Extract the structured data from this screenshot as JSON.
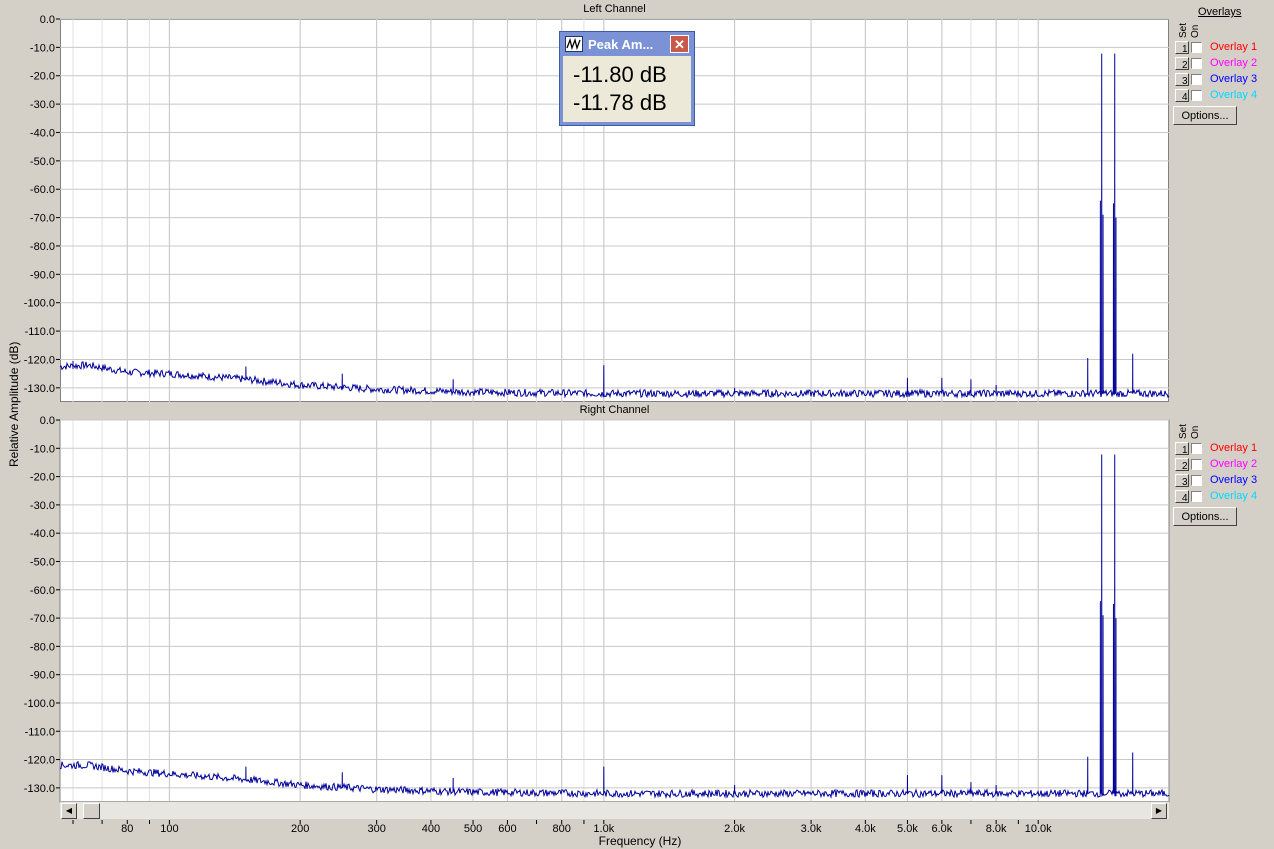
{
  "chart_data": [
    {
      "type": "line",
      "title": "Left Channel",
      "xlabel": "Frequency (Hz)",
      "ylabel": "Relative Amplitude (dB)",
      "xscale": "log",
      "xlim": [
        56,
        20000
      ],
      "ylim": [
        -135,
        0
      ],
      "grid": true,
      "y_ticks": [
        "0.0",
        "-10.0",
        "-20.0",
        "-30.0",
        "-40.0",
        "-50.0",
        "-60.0",
        "-70.0",
        "-80.0",
        "-90.0",
        "-100.0",
        "-110.0",
        "-120.0",
        "-130.0"
      ],
      "x_tick_values": [
        80,
        100,
        200,
        300,
        400,
        500,
        600,
        800,
        1000,
        2000,
        3000,
        4000,
        5000,
        6000,
        8000,
        10000
      ],
      "x_tick_labels": [
        "80",
        "100",
        "200",
        "300",
        "400",
        "500",
        "600",
        "800",
        "1.0k",
        "2.0k",
        "3.0k",
        "4.0k",
        "5.0k",
        "6.0k",
        "8.0k",
        "10.0k"
      ],
      "series": [
        {
          "color": "#000099",
          "baseline": [
            [
              56,
              -122.5
            ],
            [
              65,
              -122
            ],
            [
              80,
              -124.5
            ],
            [
              100,
              -125
            ],
            [
              150,
              -127
            ],
            [
              200,
              -129
            ],
            [
              300,
              -130.5
            ],
            [
              500,
              -131.5
            ],
            [
              1000,
              -132
            ],
            [
              2000,
              -132
            ],
            [
              5000,
              -132
            ],
            [
              10000,
              -132
            ],
            [
              20000,
              -132
            ]
          ],
          "peaks": [
            [
              60,
              -120.5
            ],
            [
              150,
              -122.5
            ],
            [
              250,
              -125
            ],
            [
              450,
              -127
            ],
            [
              1000,
              -122
            ],
            [
              2000,
              -130
            ],
            [
              5000,
              -126.5
            ],
            [
              6000,
              -126.5
            ],
            [
              7000,
              -127
            ],
            [
              8000,
              -129
            ],
            [
              13000,
              -119.5
            ],
            [
              14000,
              -12.2
            ],
            [
              15000,
              -12.2
            ],
            [
              16500,
              -118
            ],
            [
              13900,
              -64
            ],
            [
              14100,
              -69
            ],
            [
              14900,
              -65
            ],
            [
              15100,
              -70
            ]
          ]
        }
      ]
    },
    {
      "type": "line",
      "title": "Right Channel",
      "xlabel": "Frequency (Hz)",
      "ylabel": "Relative Amplitude (dB)",
      "xscale": "log",
      "xlim": [
        56,
        20000
      ],
      "ylim": [
        -135,
        0
      ],
      "grid": true,
      "y_ticks": [
        "0.0",
        "-10.0",
        "-20.0",
        "-30.0",
        "-40.0",
        "-50.0",
        "-60.0",
        "-70.0",
        "-80.0",
        "-90.0",
        "-100.0",
        "-110.0",
        "-120.0",
        "-130.0"
      ],
      "x_tick_values": [
        80,
        100,
        200,
        300,
        400,
        500,
        600,
        800,
        1000,
        2000,
        3000,
        4000,
        5000,
        6000,
        8000,
        10000
      ],
      "x_tick_labels": [
        "80",
        "100",
        "200",
        "300",
        "400",
        "500",
        "600",
        "800",
        "1.0k",
        "2.0k",
        "3.0k",
        "4.0k",
        "5.0k",
        "6.0k",
        "8.0k",
        "10.0k"
      ],
      "series": [
        {
          "color": "#000099",
          "baseline": [
            [
              56,
              -122
            ],
            [
              65,
              -122
            ],
            [
              80,
              -124
            ],
            [
              100,
              -125
            ],
            [
              150,
              -127
            ],
            [
              200,
              -129
            ],
            [
              300,
              -130.5
            ],
            [
              500,
              -131.5
            ],
            [
              1000,
              -132
            ],
            [
              2000,
              -132
            ],
            [
              5000,
              -132
            ],
            [
              10000,
              -132
            ],
            [
              20000,
              -132
            ]
          ],
          "peaks": [
            [
              150,
              -122.5
            ],
            [
              250,
              -124.5
            ],
            [
              450,
              -126.5
            ],
            [
              1000,
              -122.5
            ],
            [
              2000,
              -129
            ],
            [
              5000,
              -125.5
            ],
            [
              6000,
              -125.5
            ],
            [
              7000,
              -128
            ],
            [
              8000,
              -129
            ],
            [
              13000,
              -119
            ],
            [
              14000,
              -12.2
            ],
            [
              15000,
              -12.2
            ],
            [
              16500,
              -117.5
            ],
            [
              13900,
              -64
            ],
            [
              14100,
              -69
            ],
            [
              14900,
              -65
            ],
            [
              15100,
              -70
            ]
          ]
        }
      ]
    }
  ],
  "xlabel": "Frequency (Hz)",
  "ylabel": "Relative Amplitude (dB)",
  "overlays_panel": {
    "header": "Overlays",
    "set_label": "Set",
    "on_label": "On",
    "items": [
      {
        "set": "1",
        "label": "Overlay 1",
        "color": "#ff0000"
      },
      {
        "set": "2",
        "label": "Overlay 2",
        "color": "#ff00ff"
      },
      {
        "set": "3",
        "label": "Overlay 3",
        "color": "#0000ff"
      },
      {
        "set": "4",
        "label": "Overlay 4",
        "color": "#00d8ff"
      }
    ],
    "options_label": "Options..."
  },
  "peak_popup": {
    "title": "Peak Am...",
    "left_value": "-11.80 dB",
    "right_value": "-11.78 dB"
  }
}
